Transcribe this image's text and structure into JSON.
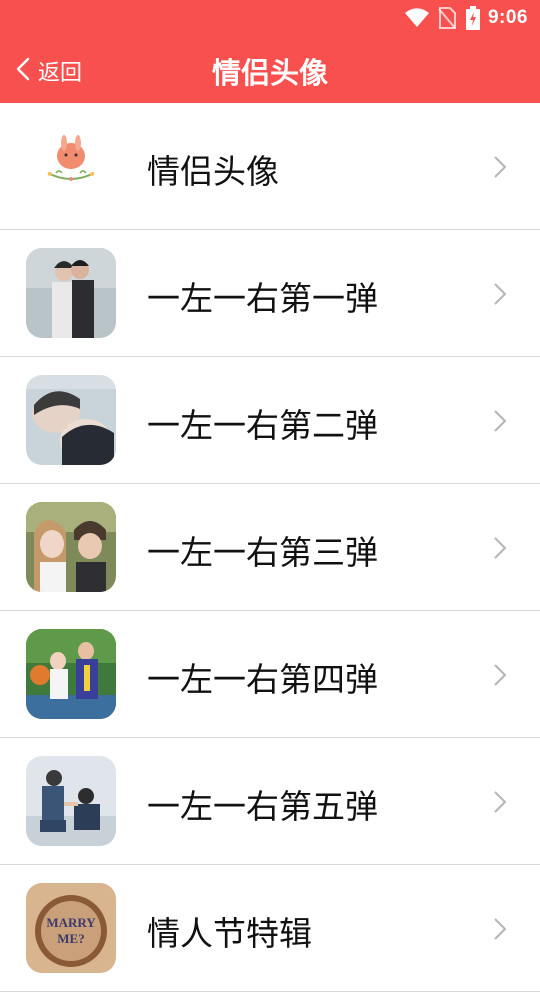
{
  "status_bar": {
    "time": "9:06",
    "icons": [
      "wifi-icon",
      "no-sim-icon",
      "battery-charging-icon"
    ]
  },
  "header": {
    "back_label": "返回",
    "title": "情侣头像",
    "background_color": "#f7504f"
  },
  "list": {
    "items": [
      {
        "label": "情侣头像",
        "thumbnail": "rabbit-illustration"
      },
      {
        "label": "一左一右第一弹",
        "thumbnail": "couple-photo-1"
      },
      {
        "label": "一左一右第二弹",
        "thumbnail": "couple-photo-2"
      },
      {
        "label": "一左一右第三弹",
        "thumbnail": "couple-photo-3"
      },
      {
        "label": "一左一右第四弹",
        "thumbnail": "couple-photo-4"
      },
      {
        "label": "一左一右第五弹",
        "thumbnail": "couple-photo-5"
      },
      {
        "label": "情人节特辑",
        "thumbnail": "marry-me-mug"
      }
    ]
  }
}
